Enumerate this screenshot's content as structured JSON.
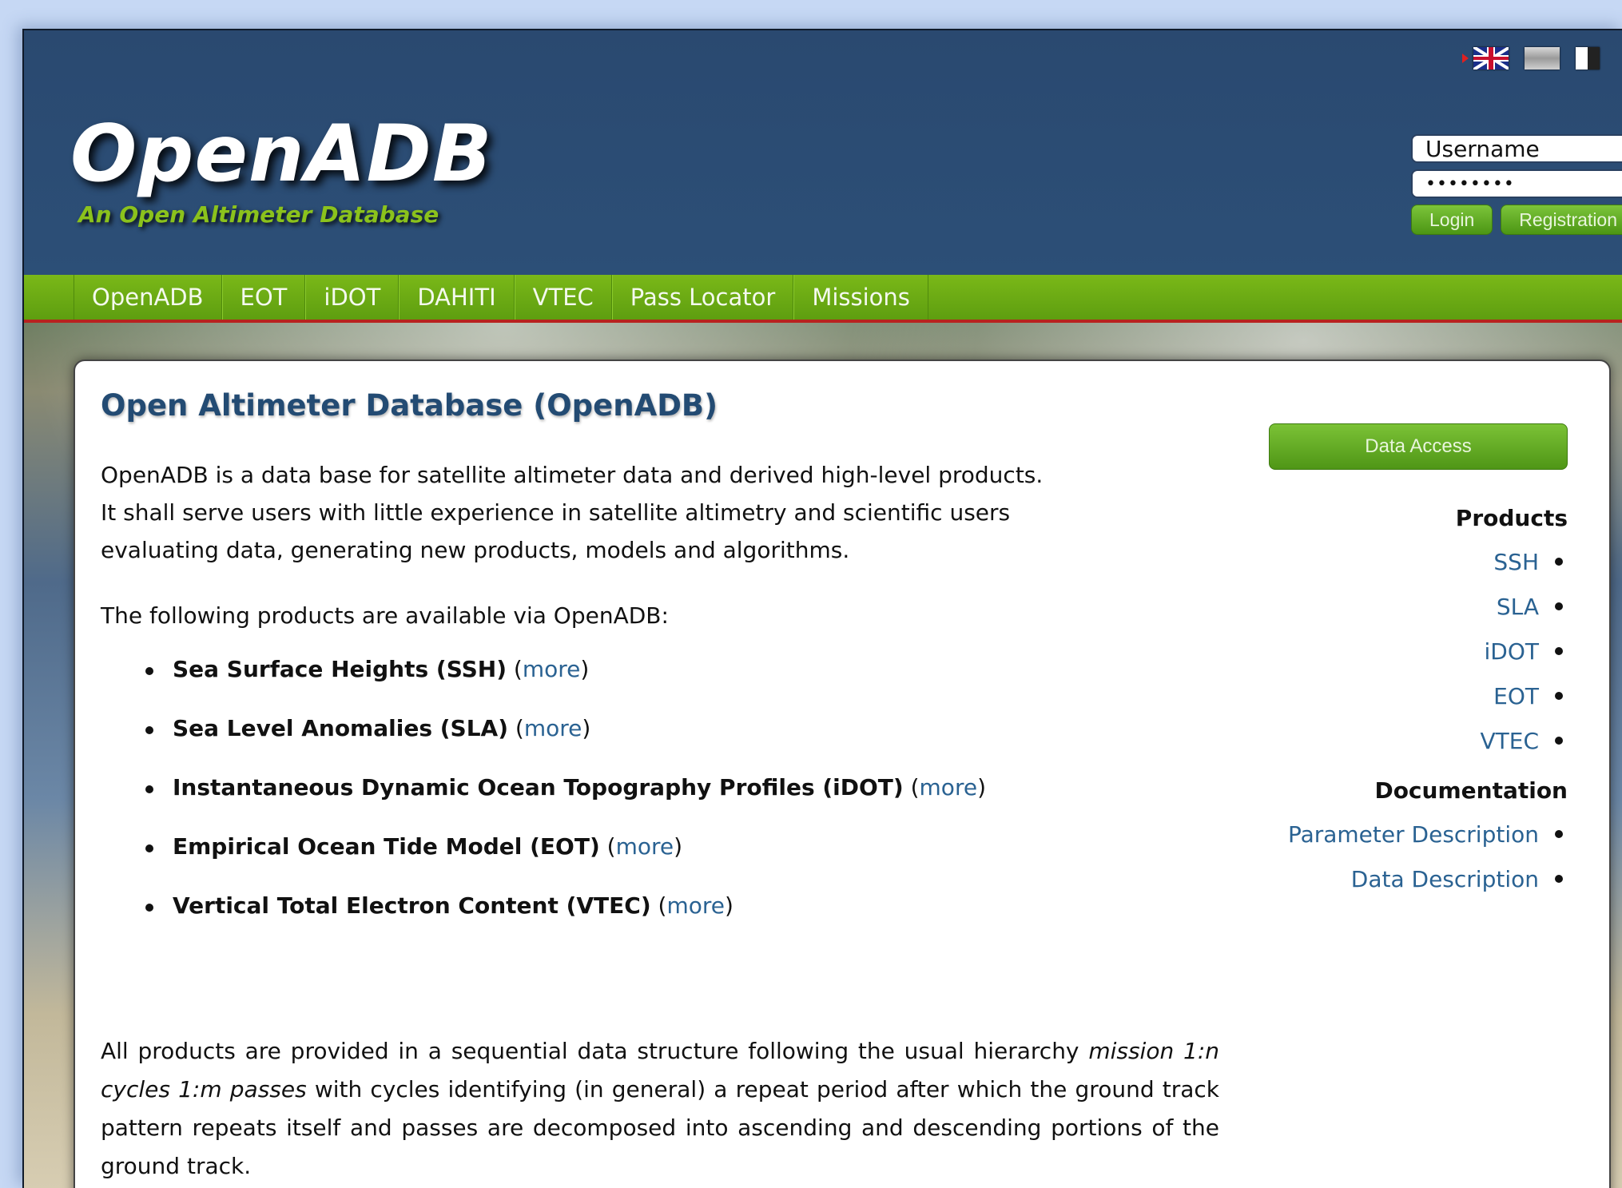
{
  "header": {
    "title": "OpenADB",
    "subtitle": "An Open Altimeter Database",
    "languages": [
      "uk-flag-icon",
      "grey-flag-icon",
      "black-white-flag-icon"
    ]
  },
  "login": {
    "username_value": "Username",
    "password_value": "••••••••",
    "login_label": "Login",
    "registration_label": "Registration"
  },
  "nav": {
    "items": [
      "OpenADB",
      "EOT",
      "iDOT",
      "DAHITI",
      "VTEC",
      "Pass Locator",
      "Missions"
    ]
  },
  "main": {
    "title": "Open Altimeter Database (OpenADB)",
    "intro": [
      "OpenADB is a data base for satellite altimeter data and derived high-level products.",
      "It shall serve users with little experience in satellite altimetry and scientific users",
      "evaluating data, generating new products, models and algorithms."
    ],
    "available": "The following products are available via OpenADB:",
    "products": [
      {
        "name": "Sea Surface Heights (SSH)",
        "more": "more"
      },
      {
        "name": "Sea Level Anomalies (SLA)",
        "more": "more"
      },
      {
        "name": "Instantaneous Dynamic Ocean Topography Profiles (iDOT)",
        "more": "more"
      },
      {
        "name": "Empirical Ocean Tide Model (EOT)",
        "more": "more"
      },
      {
        "name": "Vertical Total Electron Content (VTEC)",
        "more": "more"
      }
    ],
    "paragraph_start": "All products are provided in a sequential data structure following the usual hierarchy ",
    "paragraph_italic": "mission 1:n cycles 1:m passes",
    "paragraph_end": " with cycles identifying (in general) a repeat period after which the ground track pattern repeats itself and passes are decomposed into ascending and descending portions of the ground track."
  },
  "sidebar": {
    "data_access_label": "Data Access",
    "products_heading": "Products",
    "products": [
      "SSH",
      "SLA",
      "iDOT",
      "EOT",
      "VTEC"
    ],
    "documentation_heading": "Documentation",
    "documentation": [
      "Parameter Description",
      "Data Description"
    ]
  },
  "colors": {
    "header_bg": "#2c4f77",
    "nav_green": "#6cab14",
    "nav_border": "#b8231f",
    "title_blue": "#234b73",
    "link_blue": "#2a6292",
    "logo_green": "#8bc21c"
  }
}
